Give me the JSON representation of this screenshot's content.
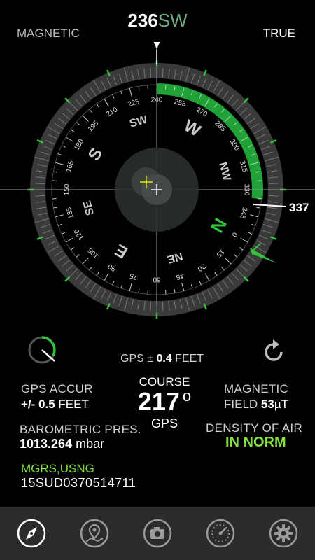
{
  "header": {
    "heading_value": "236",
    "heading_dir": "SW",
    "left_label": "MAGNETIC",
    "right_label": "TRUE"
  },
  "compass": {
    "bearing_value": "337",
    "cardinals": {
      "n": "N",
      "ne": "NE",
      "e": "E",
      "se": "SE",
      "s": "S",
      "sw": "SW",
      "w": "W",
      "nw": "NW"
    },
    "accent_color": "#1fa336"
  },
  "gps": {
    "gps_prefix": "GPS ±",
    "gps_value": "0.4",
    "gps_unit": "FEET",
    "accuracy_label": "GPS  ACCUR",
    "accuracy_prefix": "+/-",
    "accuracy_value": "0.5",
    "accuracy_unit": "FEET"
  },
  "course": {
    "label": "COURSE",
    "value": "217",
    "unit": "o",
    "sublabel": "GPS"
  },
  "magnetic": {
    "label_line1": "MAGNETIC",
    "label_line2": "FIELD",
    "value": "53",
    "unit": "µT"
  },
  "barometric": {
    "label": "BAROMETRIC PRES.",
    "value": "1013.264",
    "unit": "mbar"
  },
  "air": {
    "label": "DENSITY OF AIR",
    "value": "IN NORM"
  },
  "mgrs": {
    "label": "MGRS,USNG",
    "value": "15SUD0370514711"
  },
  "nav": {
    "items": [
      "compass-icon",
      "map-pin-icon",
      "camera-icon",
      "speedometer-icon",
      "gear-icon"
    ]
  }
}
